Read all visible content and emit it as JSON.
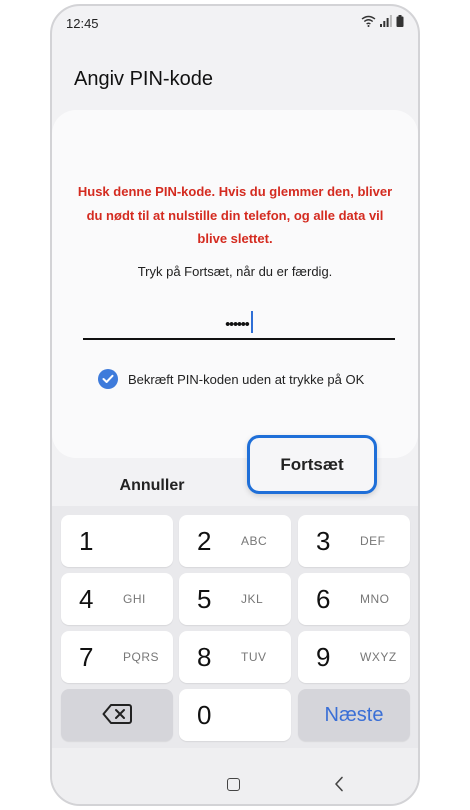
{
  "status_bar": {
    "time": "12:45"
  },
  "header": {
    "title": "Angiv PIN-kode"
  },
  "card": {
    "warning_text": "Husk denne PIN-kode. Hvis du glemmer den, bliver du nødt til at nulstille din telefon, og alle data vil blive slettet.",
    "instruction": "Tryk på Fortsæt, når du er færdig.",
    "pin_masked": "••••••",
    "confirm_label": "Bekræft PIN-koden uden at trykke på OK",
    "confirm_checked": true
  },
  "actions": {
    "cancel_label": "Annuller",
    "continue_label": "Fortsæt"
  },
  "keypad": {
    "keys": [
      {
        "digit": "1",
        "letters": ""
      },
      {
        "digit": "2",
        "letters": "ABC"
      },
      {
        "digit": "3",
        "letters": "DEF"
      },
      {
        "digit": "4",
        "letters": "GHI"
      },
      {
        "digit": "5",
        "letters": "JKL"
      },
      {
        "digit": "6",
        "letters": "MNO"
      },
      {
        "digit": "7",
        "letters": "PQRS"
      },
      {
        "digit": "8",
        "letters": "TUV"
      },
      {
        "digit": "9",
        "letters": "WXYZ"
      }
    ],
    "zero": "0",
    "next_label": "Næste"
  },
  "colors": {
    "warning": "#d42b20",
    "accent": "#3e7bdb",
    "focus_ring": "#1f6fd8",
    "next": "#3a6fd6"
  },
  "icons": [
    "wifi-icon",
    "signal-icon",
    "battery-icon",
    "checkmark-icon",
    "backspace-icon",
    "home-icon",
    "back-icon"
  ]
}
